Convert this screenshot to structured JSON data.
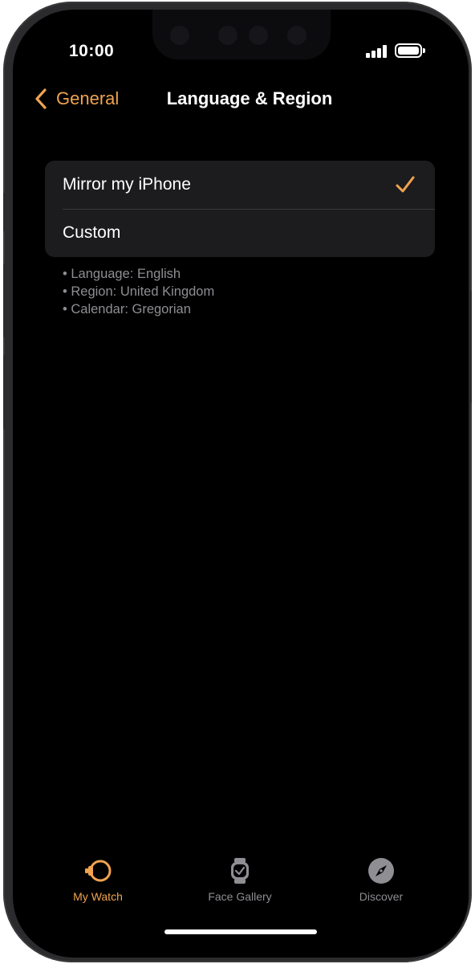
{
  "status_bar": {
    "time": "10:00",
    "signal_bars": 4,
    "battery_level": 1.0
  },
  "nav": {
    "back_label": "General",
    "title": "Language & Region"
  },
  "options": [
    {
      "label": "Mirror my iPhone",
      "selected": true
    },
    {
      "label": "Custom",
      "selected": false
    }
  ],
  "footnote": [
    "Language: English",
    "Region: United Kingdom",
    "Calendar: Gregorian"
  ],
  "tabs": [
    {
      "label": "My Watch",
      "icon": "watch-side-icon",
      "active": true
    },
    {
      "label": "Face Gallery",
      "icon": "watch-face-icon",
      "active": false
    },
    {
      "label": "Discover",
      "icon": "compass-icon",
      "active": false
    }
  ],
  "colors": {
    "accent": "#f0a350",
    "background": "#000000",
    "group_background": "#1c1c1e",
    "secondary_text": "#8e8e93"
  }
}
